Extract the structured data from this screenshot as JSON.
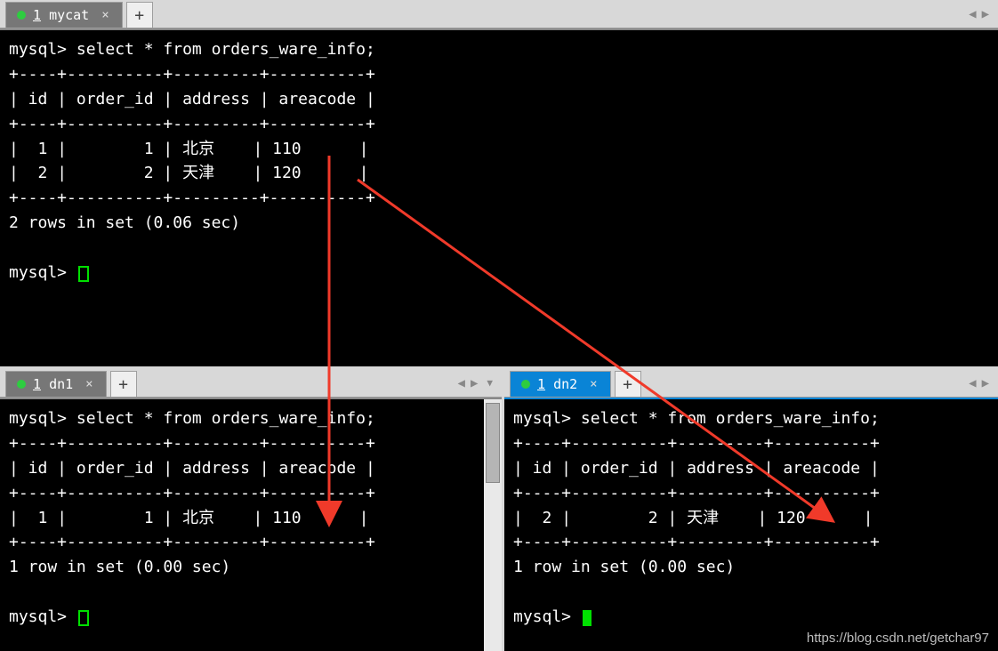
{
  "tabs": {
    "top": {
      "number": "1",
      "name": "mycat"
    },
    "bl": {
      "number": "1",
      "name": "dn1"
    },
    "br": {
      "number": "1",
      "name": "dn2"
    }
  },
  "terminals": {
    "top": {
      "prompt": "mysql>",
      "query": "select * from orders_ware_info;",
      "headers": [
        "id",
        "order_id",
        "address",
        "areacode"
      ],
      "rows": [
        {
          "id": "1",
          "order_id": "1",
          "address": "北京",
          "areacode": "110"
        },
        {
          "id": "2",
          "order_id": "2",
          "address": "天津",
          "areacode": "120"
        }
      ],
      "footer": "2 rows in set (0.06 sec)"
    },
    "bl": {
      "prompt": "mysql>",
      "query": "select * from orders_ware_info;",
      "headers": [
        "id",
        "order_id",
        "address",
        "areacode"
      ],
      "rows": [
        {
          "id": "1",
          "order_id": "1",
          "address": "北京",
          "areacode": "110"
        }
      ],
      "footer": "1 row in set (0.00 sec)"
    },
    "br": {
      "prompt": "mysql>",
      "query": "select * from orders_ware_info;",
      "headers": [
        "id",
        "order_id",
        "address",
        "areacode"
      ],
      "rows": [
        {
          "id": "2",
          "order_id": "2",
          "address": "天津",
          "areacode": "120"
        }
      ],
      "footer": "1 row in set (0.00 sec)"
    }
  },
  "watermark": "https://blog.csdn.net/getchar97",
  "border": "+----+----------+---------+----------+",
  "headerRow": "| id | order_id | address | areacode |"
}
